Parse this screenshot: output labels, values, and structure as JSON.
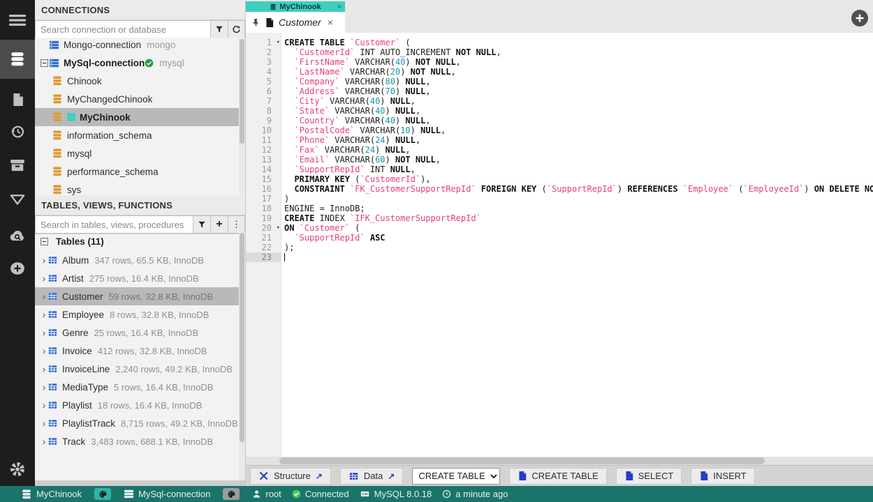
{
  "activity_bar": {
    "items": [
      "menu",
      "database",
      "file",
      "history",
      "archive",
      "filter",
      "cloud-search",
      "add",
      "settings"
    ],
    "selected": "database"
  },
  "connections_panel": {
    "title": "CONNECTIONS",
    "search_placeholder": "Search connection or database",
    "items": [
      {
        "name": "Mongo-connection",
        "engine": "mongo",
        "icon": "server",
        "level": 0
      },
      {
        "name": "MySql-connection",
        "engine": "mysql",
        "icon": "server",
        "level": 0,
        "bold": true,
        "expanded": true,
        "check": true
      },
      {
        "name": "Chinook",
        "icon": "database",
        "level": 1
      },
      {
        "name": "MyChangedChinook",
        "icon": "database",
        "level": 1
      },
      {
        "name": "MyChinook",
        "icon": "database",
        "level": 1,
        "selected": true,
        "bold": true,
        "color": "#43cfc0"
      },
      {
        "name": "information_schema",
        "icon": "database",
        "level": 1
      },
      {
        "name": "mysql",
        "icon": "database",
        "level": 1
      },
      {
        "name": "performance_schema",
        "icon": "database",
        "level": 1
      },
      {
        "name": "sys",
        "icon": "database",
        "level": 1
      }
    ]
  },
  "tables_panel": {
    "title": "TABLES, VIEWS, FUNCTIONS",
    "search_placeholder": "Search in tables, views, procedures",
    "group_label": "Tables (11)",
    "items": [
      {
        "name": "Album",
        "meta": "347 rows, 65.5 KB, InnoDB"
      },
      {
        "name": "Artist",
        "meta": "275 rows, 16.4 KB, InnoDB"
      },
      {
        "name": "Customer",
        "meta": "59 rows, 32.8 KB, InnoDB",
        "selected": true
      },
      {
        "name": "Employee",
        "meta": "8 rows, 32.8 KB, InnoDB"
      },
      {
        "name": "Genre",
        "meta": "25 rows, 16.4 KB, InnoDB"
      },
      {
        "name": "Invoice",
        "meta": "412 rows, 32.8 KB, InnoDB"
      },
      {
        "name": "InvoiceLine",
        "meta": "2,240 rows, 49.2 KB, InnoDB"
      },
      {
        "name": "MediaType",
        "meta": "5 rows, 16.4 KB, InnoDB"
      },
      {
        "name": "Playlist",
        "meta": "18 rows, 16.4 KB, InnoDB"
      },
      {
        "name": "PlaylistTrack",
        "meta": "8,715 rows, 49.2 KB, InnoDB"
      },
      {
        "name": "Track",
        "meta": "3,483 rows, 688.1 KB, InnoDB"
      }
    ]
  },
  "tabs": {
    "database_label": "MyChinook",
    "database_color": "#3fcdbd",
    "tab_title": "Customer",
    "close_glyph": "×"
  },
  "editor": {
    "cursor_line": 23,
    "lines": [
      {
        "n": 1,
        "fold": true,
        "s": [
          [
            "k",
            "CREATE TABLE"
          ],
          [
            "p",
            " "
          ],
          [
            "i",
            "`Customer`"
          ],
          [
            "p",
            " ("
          ]
        ]
      },
      {
        "n": 2,
        "s": [
          [
            "p",
            "  "
          ],
          [
            "i",
            "`CustomerId`"
          ],
          [
            "p",
            " INT AUTO_INCREMENT "
          ],
          [
            "k",
            "NOT NULL"
          ],
          [
            "p",
            ","
          ]
        ]
      },
      {
        "n": 3,
        "s": [
          [
            "p",
            "  "
          ],
          [
            "i",
            "`FirstName`"
          ],
          [
            "p",
            " VARCHAR("
          ],
          [
            "n",
            "40"
          ],
          [
            "p",
            ") "
          ],
          [
            "k",
            "NOT NULL"
          ],
          [
            "p",
            ","
          ]
        ]
      },
      {
        "n": 4,
        "s": [
          [
            "p",
            "  "
          ],
          [
            "i",
            "`LastName`"
          ],
          [
            "p",
            " VARCHAR("
          ],
          [
            "n",
            "20"
          ],
          [
            "p",
            ") "
          ],
          [
            "k",
            "NOT NULL"
          ],
          [
            "p",
            ","
          ]
        ]
      },
      {
        "n": 5,
        "s": [
          [
            "p",
            "  "
          ],
          [
            "i",
            "`Company`"
          ],
          [
            "p",
            " VARCHAR("
          ],
          [
            "n",
            "80"
          ],
          [
            "p",
            ") "
          ],
          [
            "k",
            "NULL"
          ],
          [
            "p",
            ","
          ]
        ]
      },
      {
        "n": 6,
        "s": [
          [
            "p",
            "  "
          ],
          [
            "i",
            "`Address`"
          ],
          [
            "p",
            " VARCHAR("
          ],
          [
            "n",
            "70"
          ],
          [
            "p",
            ") "
          ],
          [
            "k",
            "NULL"
          ],
          [
            "p",
            ","
          ]
        ]
      },
      {
        "n": 7,
        "s": [
          [
            "p",
            "  "
          ],
          [
            "i",
            "`City`"
          ],
          [
            "p",
            " VARCHAR("
          ],
          [
            "n",
            "40"
          ],
          [
            "p",
            ") "
          ],
          [
            "k",
            "NULL"
          ],
          [
            "p",
            ","
          ]
        ]
      },
      {
        "n": 8,
        "s": [
          [
            "p",
            "  "
          ],
          [
            "i",
            "`State`"
          ],
          [
            "p",
            " VARCHAR("
          ],
          [
            "n",
            "40"
          ],
          [
            "p",
            ") "
          ],
          [
            "k",
            "NULL"
          ],
          [
            "p",
            ","
          ]
        ]
      },
      {
        "n": 9,
        "s": [
          [
            "p",
            "  "
          ],
          [
            "i",
            "`Country`"
          ],
          [
            "p",
            " VARCHAR("
          ],
          [
            "n",
            "40"
          ],
          [
            "p",
            ") "
          ],
          [
            "k",
            "NULL"
          ],
          [
            "p",
            ","
          ]
        ]
      },
      {
        "n": 10,
        "s": [
          [
            "p",
            "  "
          ],
          [
            "i",
            "`PostalCode`"
          ],
          [
            "p",
            " VARCHAR("
          ],
          [
            "n",
            "10"
          ],
          [
            "p",
            ") "
          ],
          [
            "k",
            "NULL"
          ],
          [
            "p",
            ","
          ]
        ]
      },
      {
        "n": 11,
        "s": [
          [
            "p",
            "  "
          ],
          [
            "i",
            "`Phone`"
          ],
          [
            "p",
            " VARCHAR("
          ],
          [
            "n",
            "24"
          ],
          [
            "p",
            ") "
          ],
          [
            "k",
            "NULL"
          ],
          [
            "p",
            ","
          ]
        ]
      },
      {
        "n": 12,
        "s": [
          [
            "p",
            "  "
          ],
          [
            "i",
            "`Fax`"
          ],
          [
            "p",
            " VARCHAR("
          ],
          [
            "n",
            "24"
          ],
          [
            "p",
            ") "
          ],
          [
            "k",
            "NULL"
          ],
          [
            "p",
            ","
          ]
        ]
      },
      {
        "n": 13,
        "s": [
          [
            "p",
            "  "
          ],
          [
            "i",
            "`Email`"
          ],
          [
            "p",
            " VARCHAR("
          ],
          [
            "n",
            "60"
          ],
          [
            "p",
            ") "
          ],
          [
            "k",
            "NOT NULL"
          ],
          [
            "p",
            ","
          ]
        ]
      },
      {
        "n": 14,
        "s": [
          [
            "p",
            "  "
          ],
          [
            "i",
            "`SupportRepId`"
          ],
          [
            "p",
            " INT "
          ],
          [
            "k",
            "NULL"
          ],
          [
            "p",
            ","
          ]
        ]
      },
      {
        "n": 15,
        "s": [
          [
            "p",
            "  "
          ],
          [
            "k",
            "PRIMARY KEY"
          ],
          [
            "p",
            " ("
          ],
          [
            "i",
            "`CustomerId`"
          ],
          [
            "p",
            "),"
          ]
        ]
      },
      {
        "n": 16,
        "s": [
          [
            "p",
            "  "
          ],
          [
            "k",
            "CONSTRAINT"
          ],
          [
            "p",
            " "
          ],
          [
            "i",
            "`FK_CustomerSupportRepId`"
          ],
          [
            "p",
            " "
          ],
          [
            "k",
            "FOREIGN KEY"
          ],
          [
            "p",
            " ("
          ],
          [
            "i",
            "`SupportRepId`"
          ],
          [
            "p",
            ") "
          ],
          [
            "k",
            "REFERENCES"
          ],
          [
            "p",
            " "
          ],
          [
            "i",
            "`Employee`"
          ],
          [
            "p",
            " ("
          ],
          [
            "i",
            "`EmployeeId`"
          ],
          [
            "p",
            ") "
          ],
          [
            "k",
            "ON DELETE NO"
          ]
        ]
      },
      {
        "n": 17,
        "s": [
          [
            "p",
            ")"
          ]
        ]
      },
      {
        "n": 18,
        "s": [
          [
            "p",
            "ENGINE = InnoDB;"
          ]
        ]
      },
      {
        "n": 19,
        "s": [
          [
            "k",
            "CREATE"
          ],
          [
            "p",
            " INDEX "
          ],
          [
            "i",
            "`IFK_CustomerSupportRepId`"
          ]
        ]
      },
      {
        "n": 20,
        "fold": true,
        "s": [
          [
            "k",
            "ON"
          ],
          [
            "p",
            " "
          ],
          [
            "i",
            "`Customer`"
          ],
          [
            "p",
            " ("
          ]
        ]
      },
      {
        "n": 21,
        "s": [
          [
            "p",
            "  "
          ],
          [
            "i",
            "`SupportRepId`"
          ],
          [
            "p",
            " "
          ],
          [
            "k",
            "ASC"
          ]
        ]
      },
      {
        "n": 22,
        "s": [
          [
            "p",
            ");"
          ]
        ]
      },
      {
        "n": 23,
        "cursor": true,
        "s": []
      }
    ]
  },
  "toolbar": {
    "nav_buttons": [
      {
        "label": "Structure",
        "icon": "tools"
      },
      {
        "label": "Data",
        "icon": "table"
      }
    ],
    "dropdown_value": "CREATE TABLE",
    "action_buttons": [
      {
        "label": "CREATE TABLE",
        "icon": "sqlfile"
      },
      {
        "label": "SELECT",
        "icon": "sqlfile"
      },
      {
        "label": "INSERT",
        "icon": "sqlfile"
      }
    ]
  },
  "status_bar": {
    "database": {
      "label": "MyChinook"
    },
    "database_color": "#2fb3a4",
    "connection": {
      "label": "MySql-connection"
    },
    "connection_color": "#9b9b9b",
    "user": {
      "label": "root"
    },
    "status": {
      "label": "Connected"
    },
    "version": {
      "label": "MySQL 8.0.18"
    },
    "time": {
      "label": "a minute ago"
    }
  }
}
